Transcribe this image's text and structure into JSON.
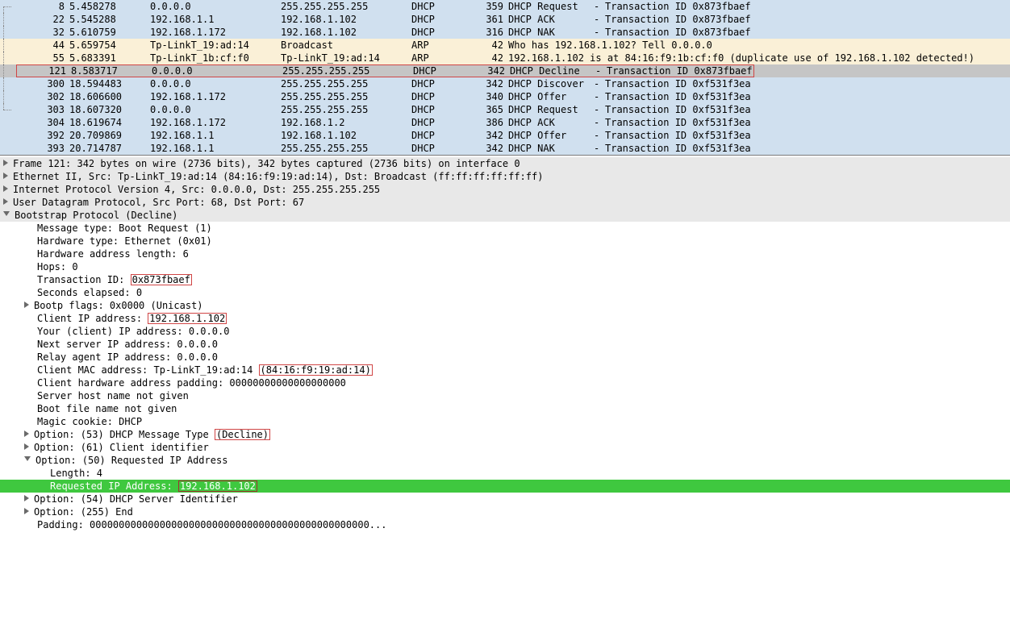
{
  "packets": [
    {
      "tree": "top",
      "bg": "light",
      "no": "8",
      "time": "5.458278",
      "src": "0.0.0.0",
      "dst": "255.255.255.255",
      "proto": "DHCP",
      "len": "359",
      "op": "DHCP Request",
      "dash": "-",
      "rest": "Transaction ID 0x873fbaef"
    },
    {
      "tree": "mid",
      "bg": "light",
      "no": "22",
      "time": "5.545288",
      "src": "192.168.1.1",
      "dst": "192.168.1.102",
      "proto": "DHCP",
      "len": "361",
      "op": "DHCP ACK",
      "dash": "-",
      "rest": "Transaction ID 0x873fbaef"
    },
    {
      "tree": "mid",
      "bg": "light",
      "no": "32",
      "time": "5.610759",
      "src": "192.168.1.172",
      "dst": "192.168.1.102",
      "proto": "DHCP",
      "len": "316",
      "op": "DHCP NAK",
      "dash": "-",
      "rest": "Transaction ID 0x873fbaef"
    },
    {
      "tree": "mid",
      "bg": "cream",
      "no": "44",
      "time": "5.659754",
      "src": "Tp-LinkT_19:ad:14",
      "dst": "Broadcast",
      "proto": "ARP",
      "len": "42",
      "full": "Who has 192.168.1.102? Tell 0.0.0.0"
    },
    {
      "tree": "mid",
      "bg": "cream",
      "no": "55",
      "time": "5.683391",
      "src": "Tp-LinkT_1b:cf:f0",
      "dst": "Tp-LinkT_19:ad:14",
      "proto": "ARP",
      "len": "42",
      "full": "192.168.1.102 is at 84:16:f9:1b:cf:f0 (duplicate use of 192.168.1.102 detected!)"
    },
    {
      "tree": "mid",
      "bg": "grey",
      "no": "121",
      "time": "8.583717",
      "src": "0.0.0.0",
      "dst": "255.255.255.255",
      "proto": "DHCP",
      "len": "342",
      "op": "DHCP Decline",
      "dash": "-",
      "rest": "Transaction ID 0x873fbaef",
      "redrow": true
    },
    {
      "tree": "mid",
      "bg": "light",
      "no": "300",
      "time": "18.594483",
      "src": "0.0.0.0",
      "dst": "255.255.255.255",
      "proto": "DHCP",
      "len": "342",
      "op": "DHCP Discover",
      "dash": "-",
      "rest": "Transaction ID 0xf531f3ea"
    },
    {
      "tree": "mid",
      "bg": "light",
      "no": "302",
      "time": "18.606600",
      "src": "192.168.1.172",
      "dst": "255.255.255.255",
      "proto": "DHCP",
      "len": "340",
      "op": "DHCP Offer",
      "dash": "-",
      "rest": "Transaction ID 0xf531f3ea"
    },
    {
      "tree": "last",
      "bg": "light",
      "no": "303",
      "time": "18.607320",
      "src": "0.0.0.0",
      "dst": "255.255.255.255",
      "proto": "DHCP",
      "len": "365",
      "op": "DHCP Request",
      "dash": "-",
      "rest": "Transaction ID 0xf531f3ea"
    },
    {
      "tree": "",
      "bg": "light",
      "no": "304",
      "time": "18.619674",
      "src": "192.168.1.172",
      "dst": "192.168.1.2",
      "proto": "DHCP",
      "len": "386",
      "op": "DHCP ACK",
      "dash": "-",
      "rest": "Transaction ID 0xf531f3ea"
    },
    {
      "tree": "",
      "bg": "light",
      "no": "392",
      "time": "20.709869",
      "src": "192.168.1.1",
      "dst": "192.168.1.102",
      "proto": "DHCP",
      "len": "342",
      "op": "DHCP Offer",
      "dash": "-",
      "rest": "Transaction ID 0xf531f3ea"
    },
    {
      "tree": "",
      "bg": "light",
      "no": "393",
      "time": "20.714787",
      "src": "192.168.1.1",
      "dst": "255.255.255.255",
      "proto": "DHCP",
      "len": "342",
      "op": "DHCP NAK",
      "dash": "-",
      "rest": "Transaction ID 0xf531f3ea"
    }
  ],
  "details": {
    "frame": "Frame 121: 342 bytes on wire (2736 bits), 342 bytes captured (2736 bits) on interface 0",
    "eth": "Ethernet II, Src: Tp-LinkT_19:ad:14 (84:16:f9:19:ad:14), Dst: Broadcast (ff:ff:ff:ff:ff:ff)",
    "ip": "Internet Protocol Version 4, Src: 0.0.0.0, Dst: 255.255.255.255",
    "udp": "User Datagram Protocol, Src Port: 68, Dst Port: 67",
    "bootp": "Bootstrap Protocol (Decline)",
    "msg_type": "Message type: Boot Request (1)",
    "hw_type": "Hardware type: Ethernet (0x01)",
    "hw_len": "Hardware address length: 6",
    "hops": "Hops: 0",
    "xid_label": "Transaction ID: ",
    "xid_value": "0x873fbaef",
    "secs": "Seconds elapsed: 0",
    "flags": "Bootp flags: 0x0000 (Unicast)",
    "ciaddr_label": "Client IP address: ",
    "ciaddr_value": "192.168.1.102",
    "yiaddr": "Your (client) IP address: 0.0.0.0",
    "siaddr": "Next server IP address: 0.0.0.0",
    "giaddr": "Relay agent IP address: 0.0.0.0",
    "mac_label": "Client MAC address: Tp-LinkT_19:ad:14 ",
    "mac_value": "(84:16:f9:19:ad:14)",
    "hwpad": "Client hardware address padding: 00000000000000000000",
    "sname": "Server host name not given",
    "bfile": "Boot file name not given",
    "cookie": "Magic cookie: DHCP",
    "opt53_label": "Option: (53) DHCP Message Type ",
    "opt53_value": "(Decline)",
    "opt61": "Option: (61) Client identifier",
    "opt50": "Option: (50) Requested IP Address",
    "opt50_len": "Length: 4",
    "opt50_req_label": "Requested IP Address: ",
    "opt50_req_value": "192.168.1.102",
    "opt54": "Option: (54) DHCP Server Identifier",
    "opt255": "Option: (255) End",
    "padding": "Padding: 000000000000000000000000000000000000000000000000..."
  }
}
